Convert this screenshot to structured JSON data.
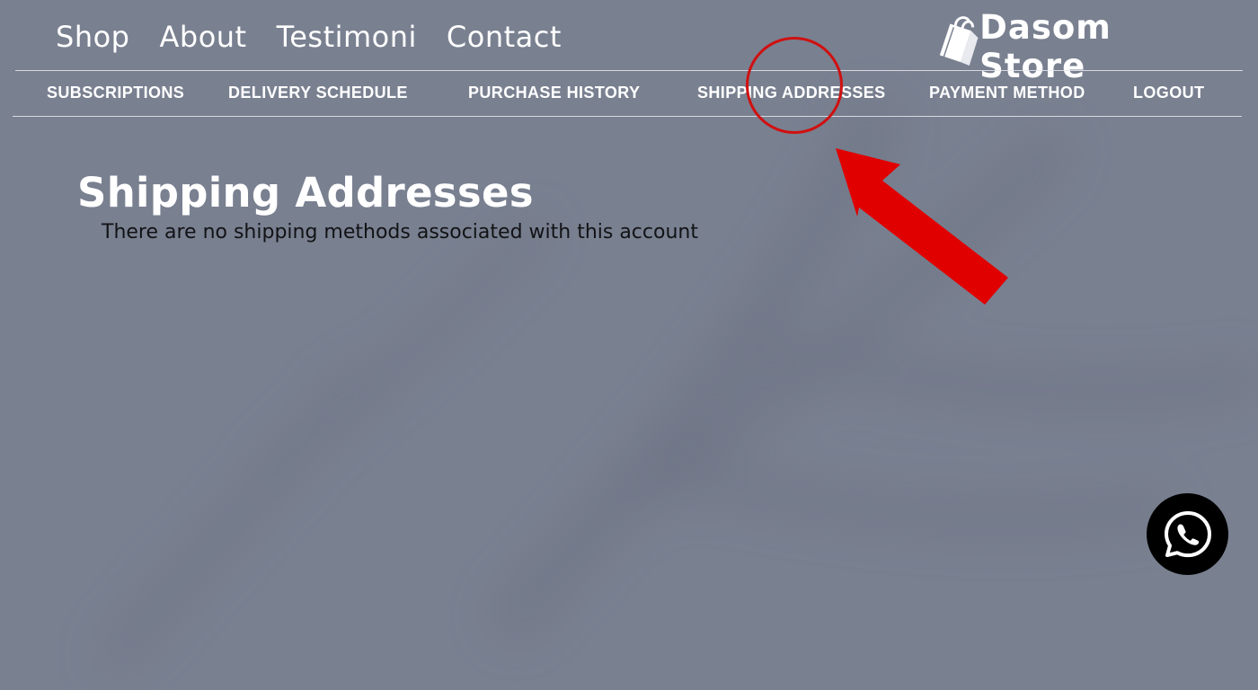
{
  "top_nav": {
    "items": [
      {
        "label": "Shop"
      },
      {
        "label": "About"
      },
      {
        "label": "Testimoni"
      },
      {
        "label": "Contact"
      }
    ]
  },
  "brand": {
    "name": "Dasom Store",
    "logo_icon": "shopping-bag-icon"
  },
  "account_nav": {
    "items": [
      {
        "label": "SUBSCRIPTIONS"
      },
      {
        "label": "DELIVERY SCHEDULE"
      },
      {
        "label": "PURCHASE HISTORY"
      },
      {
        "label": "SHIPPING ADDRESSES"
      },
      {
        "label": "PAYMENT METHOD"
      },
      {
        "label": "LOGOUT"
      }
    ],
    "active": "SHIPPING ADDRESSES"
  },
  "main": {
    "title": "Shipping Addresses",
    "empty_message": "There are no shipping methods associated with this account"
  },
  "annotation": {
    "color": "#d01010",
    "shapes": [
      "circle",
      "arrow"
    ]
  },
  "chat_button": {
    "icon": "whatsapp-icon",
    "background": "#000000"
  },
  "colors": {
    "background": "#798090",
    "text_light": "#ffffff",
    "text_dark": "#121316"
  }
}
